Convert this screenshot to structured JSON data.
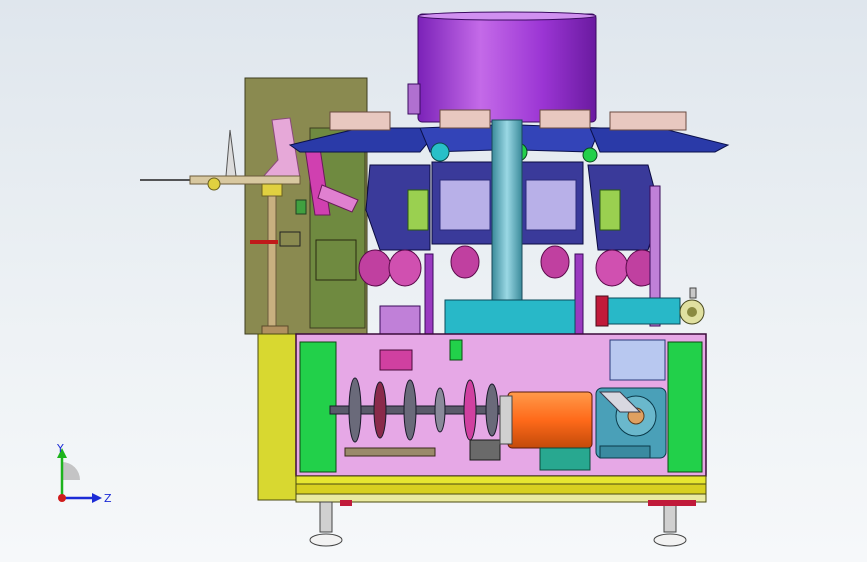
{
  "viewport": {
    "background_top": "#dfe6ed",
    "background_bottom": "#f6f8fa"
  },
  "triad": {
    "y_label": "Y",
    "z_label": "Z",
    "y_color": "#1db31d",
    "z_color": "#1c2bd6",
    "x_color": "#d01c1c"
  },
  "model": {
    "drum_color": "#a040d0",
    "frame_color": "#d8d830",
    "panel_color": "#e6a8e6",
    "motor_color": "#ff6a1a",
    "gearbox_color": "#4aa0b8",
    "arm_color": "#1f2a8c",
    "accent_green": "#22d04a"
  }
}
